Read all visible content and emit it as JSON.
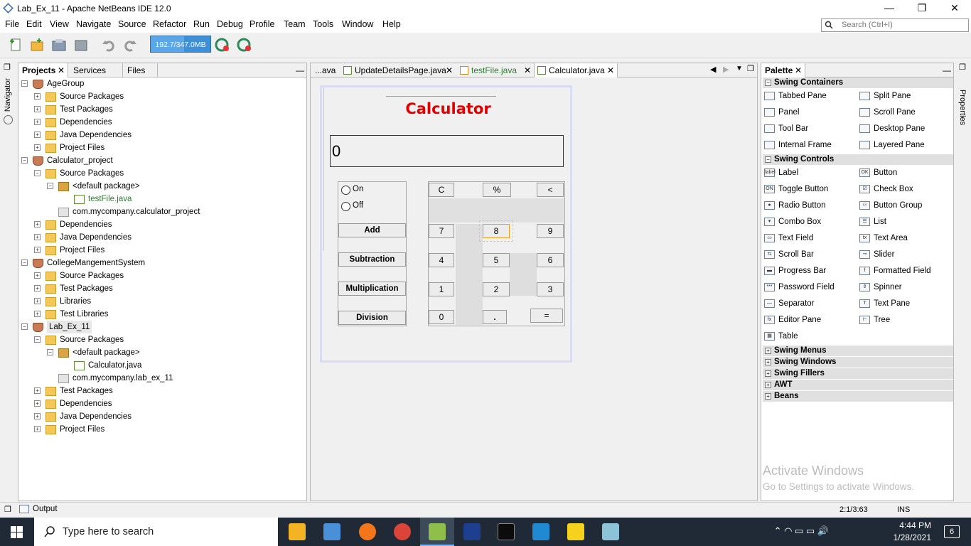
{
  "window": {
    "title": "Lab_Ex_11 - Apache NetBeans IDE 12.0",
    "controls": {
      "minimize": "—",
      "restore": "❐",
      "close": "✕"
    }
  },
  "menu": [
    "File",
    "Edit",
    "View",
    "Navigate",
    "Source",
    "Refactor",
    "Run",
    "Debug",
    "Profile",
    "Team",
    "Tools",
    "Window",
    "Help"
  ],
  "search": {
    "placeholder": "Search (Ctrl+I)",
    "icon": "search-icon"
  },
  "toolbar": {
    "memory": "192.7/347.0MB",
    "memory_used_fraction": 0.555,
    "icons": [
      "new-file-icon",
      "new-project-icon",
      "open-project-icon",
      "close-project-icon",
      "undo-icon",
      "redo-icon",
      "profile-gc-icon",
      "profile-snapshot-icon"
    ]
  },
  "left_strip": {
    "navigator": "Navigator"
  },
  "right_strip": {
    "properties": "Properties"
  },
  "projects_panel": {
    "tabs": [
      "Projects",
      "Services",
      "Files"
    ],
    "minimize": "—",
    "tree": [
      {
        "label": "AgeGroup",
        "depth": 0,
        "icon": "project-icon",
        "expander": "−"
      },
      {
        "label": "Source Packages",
        "depth": 1,
        "icon": "folder-icon",
        "expander": "+"
      },
      {
        "label": "Test Packages",
        "depth": 1,
        "icon": "folder-icon",
        "expander": "+"
      },
      {
        "label": "Dependencies",
        "depth": 1,
        "icon": "folder-icon",
        "expander": "+"
      },
      {
        "label": "Java Dependencies",
        "depth": 1,
        "icon": "folder-icon",
        "expander": "+"
      },
      {
        "label": "Project Files",
        "depth": 1,
        "icon": "folder-icon",
        "expander": "+"
      },
      {
        "label": "Calculator_project",
        "depth": 0,
        "icon": "project-icon",
        "expander": "−"
      },
      {
        "label": "Source Packages",
        "depth": 1,
        "icon": "folder-icon",
        "expander": "−"
      },
      {
        "label": "<default package>",
        "depth": 2,
        "icon": "package-icon",
        "expander": "−"
      },
      {
        "label": "testFile.java",
        "depth": 3,
        "icon": "java-file-icon",
        "expander": "",
        "color": "#2e7d32"
      },
      {
        "label": "com.mycompany.calculator_project",
        "depth": 2,
        "icon": "empty-package-icon",
        "expander": ""
      },
      {
        "label": "Dependencies",
        "depth": 1,
        "icon": "folder-icon",
        "expander": "+"
      },
      {
        "label": "Java Dependencies",
        "depth": 1,
        "icon": "folder-icon",
        "expander": "+"
      },
      {
        "label": "Project Files",
        "depth": 1,
        "icon": "folder-icon",
        "expander": "+"
      },
      {
        "label": "CollegeMangementSystem",
        "depth": 0,
        "icon": "project-icon",
        "expander": "−"
      },
      {
        "label": "Source Packages",
        "depth": 1,
        "icon": "folder-icon",
        "expander": "+"
      },
      {
        "label": "Test Packages",
        "depth": 1,
        "icon": "folder-icon",
        "expander": "+"
      },
      {
        "label": "Libraries",
        "depth": 1,
        "icon": "folder-icon",
        "expander": "+"
      },
      {
        "label": "Test Libraries",
        "depth": 1,
        "icon": "folder-icon",
        "expander": "+"
      },
      {
        "label": "Lab_Ex_11",
        "depth": 0,
        "icon": "project-icon",
        "expander": "−",
        "selected": true
      },
      {
        "label": "Source Packages",
        "depth": 1,
        "icon": "folder-icon",
        "expander": "−"
      },
      {
        "label": "<default package>",
        "depth": 2,
        "icon": "package-icon",
        "expander": "−"
      },
      {
        "label": "Calculator.java",
        "depth": 3,
        "icon": "java-form-icon",
        "expander": ""
      },
      {
        "label": "com.mycompany.lab_ex_11",
        "depth": 2,
        "icon": "empty-package-icon",
        "expander": ""
      },
      {
        "label": "Test Packages",
        "depth": 1,
        "icon": "folder-icon",
        "expander": "+"
      },
      {
        "label": "Dependencies",
        "depth": 1,
        "icon": "folder-icon",
        "expander": "+"
      },
      {
        "label": "Java Dependencies",
        "depth": 1,
        "icon": "folder-icon",
        "expander": "+"
      },
      {
        "label": "Project Files",
        "depth": 1,
        "icon": "folder-icon",
        "expander": "+"
      }
    ]
  },
  "editor": {
    "tabs": [
      {
        "label": "...ava",
        "close": "✕"
      },
      {
        "label": "UpdateDetailsPage.java",
        "close": "✕"
      },
      {
        "label": "testFile.java",
        "close": "✕",
        "color": "#2e7d32"
      },
      {
        "label": "Calculator.java",
        "close": "✕",
        "active": true
      }
    ],
    "nav": {
      "left": "◀",
      "right": "▶",
      "dropdown": "▼",
      "maximize": "❐"
    },
    "form": {
      "title": "Calculator",
      "title_color": "#e00000",
      "display": "0",
      "radios": [
        "On",
        "Off"
      ],
      "op_buttons": [
        "Add",
        "Subtraction",
        "Multiplication",
        "Division"
      ],
      "top_buttons": [
        "C",
        "%",
        "<"
      ],
      "digits": [
        "7",
        "8",
        "9",
        "4",
        "5",
        "6",
        "1",
        "2",
        "3",
        "0",
        ".",
        "="
      ]
    }
  },
  "palette": {
    "tab": "Palette",
    "close": "✕",
    "minimize": "—",
    "swing_containers": {
      "label": "Swing Containers",
      "expander": "−",
      "items": [
        "Tabbed Pane",
        "Split Pane",
        "Panel",
        "Scroll Pane",
        "Tool Bar",
        "Desktop Pane",
        "Internal Frame",
        "Layered Pane"
      ]
    },
    "swing_controls": {
      "label": "Swing Controls",
      "expander": "−",
      "items": [
        "Label",
        "Button",
        "Toggle Button",
        "Check Box",
        "Radio Button",
        "Button Group",
        "Combo Box",
        "List",
        "Text Field",
        "Text Area",
        "Scroll Bar",
        "Slider",
        "Progress Bar",
        "Formatted Field",
        "Password Field",
        "Spinner",
        "Separator",
        "Text Pane",
        "Editor Pane",
        "Tree",
        "Table"
      ],
      "icon_glyphs": [
        "label",
        "OK",
        "ON",
        "☑",
        "●",
        "⚇",
        "▾",
        "☰",
        "▭",
        "tx",
        "⇆",
        "⊸",
        "▬",
        "f",
        "***",
        "⇕",
        "—",
        "T",
        "fx",
        "⊢",
        "▦"
      ]
    },
    "collapsed": [
      {
        "label": "Swing Menus",
        "expander": "+"
      },
      {
        "label": "Swing Windows",
        "expander": "+"
      },
      {
        "label": "Swing Fillers",
        "expander": "+"
      },
      {
        "label": "AWT",
        "expander": "+"
      },
      {
        "label": "Beans",
        "expander": "+"
      }
    ],
    "watermark": {
      "line1": "Activate Windows",
      "line2": "Go to Settings to activate Windows."
    }
  },
  "statusbar": {
    "output": "Output",
    "position": "2:1/3:63",
    "mode": "INS"
  },
  "taskbar": {
    "search_placeholder": "Type here to search",
    "apps": [
      "file-explorer-icon",
      "network-icon",
      "firefox-icon",
      "chrome-icon",
      "netbeans-icon",
      "devcpp-icon",
      "terminal-icon",
      "vscode-icon",
      "sticky-notes-icon",
      "paint-icon"
    ],
    "time": "4:44 PM",
    "date": "1/28/2021",
    "notifications": "6",
    "tray_glyphs": "⌃  ◠  ▭  ▭  🔊"
  }
}
